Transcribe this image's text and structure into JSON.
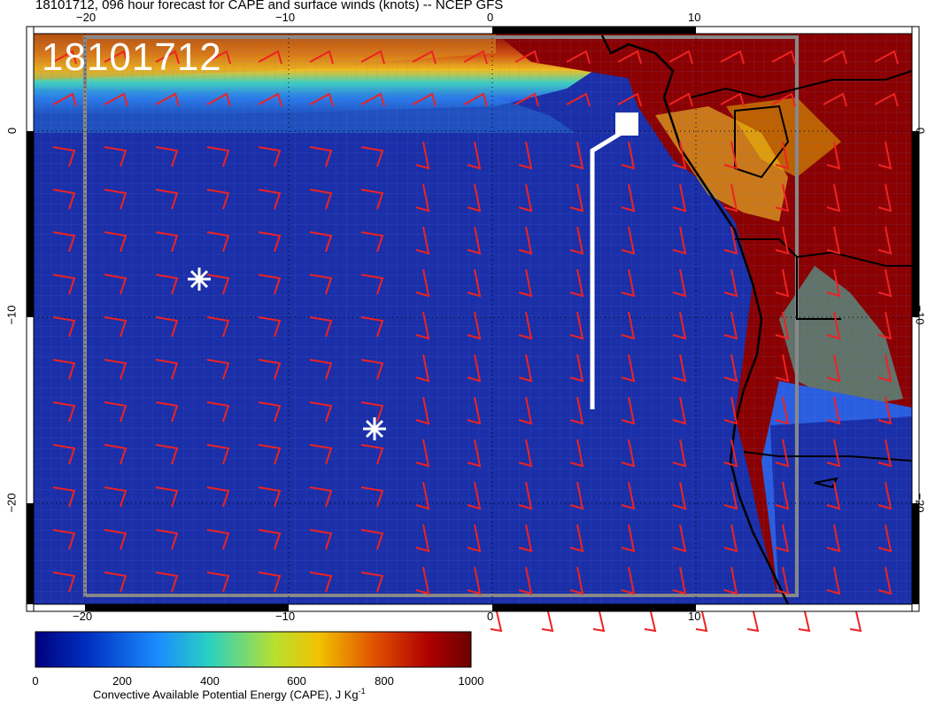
{
  "header": {
    "title": "18101712, 096 hour forecast for CAPE and surface winds (knots) -- NCEP GFS"
  },
  "map": {
    "stamp": "18101712",
    "lon_ticks_top": [
      "−20",
      "−10",
      "0",
      "10"
    ],
    "lon_ticks_bottom": [
      "−20",
      "−10",
      "0",
      "10"
    ],
    "lat_ticks_left": [
      "0",
      "−10",
      "−20"
    ],
    "lat_ticks_right": [
      "0",
      "−10",
      "−20"
    ],
    "colors": {
      "ocean_low": "#1a2fa8",
      "ocean_mid": "#2a5ee0",
      "high": "#8b0000",
      "barbs": "#ee2222",
      "coast": "#000000",
      "markers": "#ffffff"
    },
    "markers": [
      "star-marker-1",
      "star-marker-2"
    ]
  },
  "colorbar": {
    "ticks": [
      "0",
      "200",
      "400",
      "600",
      "800",
      "1000"
    ],
    "label": "Convective Available Potential Energy (CAPE), J Kg",
    "label_superscript": "-1",
    "colors": [
      "#00007f",
      "#0030c0",
      "#1a8cff",
      "#2ad1c0",
      "#b8e030",
      "#f2c200",
      "#e05000",
      "#b00000",
      "#6b0000"
    ]
  }
}
